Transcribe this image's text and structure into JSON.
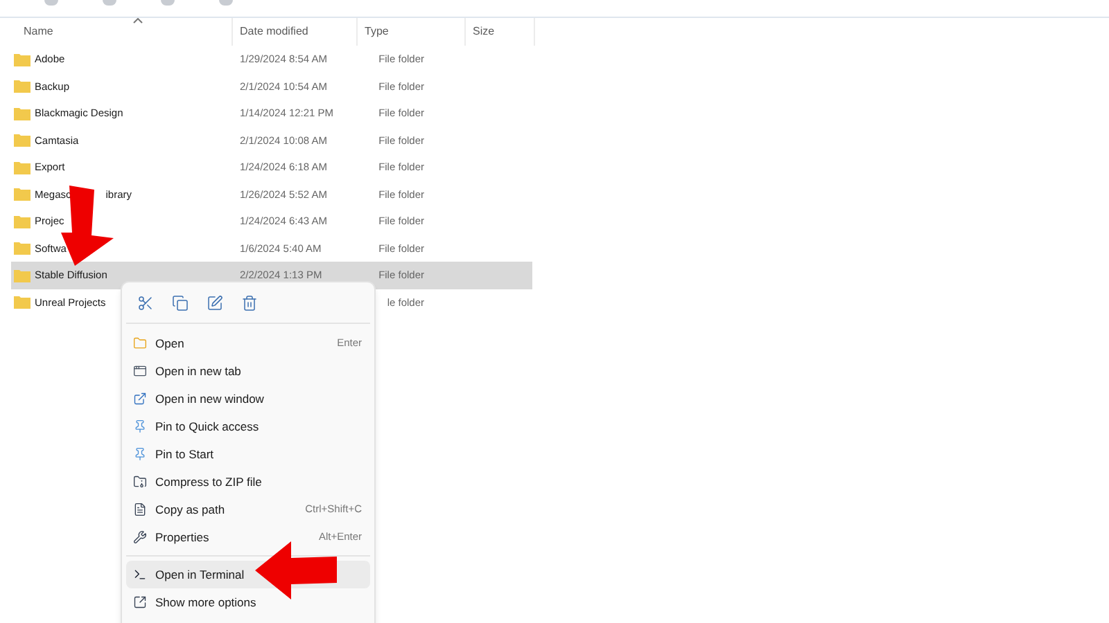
{
  "columns": [
    "Name",
    "Date modified",
    "Type",
    "Size"
  ],
  "rows": [
    {
      "name": "Adobe",
      "date": "1/29/2024 8:54 AM",
      "type": "File folder",
      "selected": false
    },
    {
      "name": "Backup",
      "date": "2/1/2024 10:54 AM",
      "type": "File folder",
      "selected": false
    },
    {
      "name": "Blackmagic Design",
      "date": "1/14/2024 12:21 PM",
      "type": "File folder",
      "selected": false
    },
    {
      "name": "Camtasia",
      "date": "2/1/2024 10:08 AM",
      "type": "File folder",
      "selected": false
    },
    {
      "name": "Export",
      "date": "1/24/2024 6:18 AM",
      "type": "File folder",
      "selected": false
    },
    {
      "name": "Megasc",
      "name_after_arrow": "ibrary",
      "date": "1/26/2024 5:52 AM",
      "type": "File folder",
      "selected": false
    },
    {
      "name": "Projec",
      "date": "1/24/2024 6:43 AM",
      "type": "File folder",
      "selected": false
    },
    {
      "name": "Softwa",
      "date": "1/6/2024 5:40 AM",
      "type": "File folder",
      "selected": false
    },
    {
      "name": "Stable Diffusion",
      "date": "2/2/2024 1:13 PM",
      "type": "File folder",
      "selected": true
    },
    {
      "name": "Unreal Projects",
      "type": "le folder",
      "selected": false
    }
  ],
  "context_menu": {
    "items": [
      {
        "label": "Open",
        "shortcut": "Enter",
        "selected": false
      },
      {
        "label": "Open in new tab",
        "selected": false
      },
      {
        "label": "Open in new window",
        "selected": false
      },
      {
        "label": "Pin to Quick access",
        "selected": false
      },
      {
        "label": "Pin to Start",
        "selected": false
      },
      {
        "label": "Compress to ZIP file",
        "selected": false
      },
      {
        "label": "Copy as path",
        "shortcut": "Ctrl+Shift+C",
        "selected": false
      },
      {
        "label": "Properties",
        "shortcut": "Alt+Enter",
        "selected": false,
        "separator_after": true
      },
      {
        "label": "Open in Terminal",
        "selected": true
      },
      {
        "label": "Show more options",
        "selected": false
      }
    ]
  }
}
